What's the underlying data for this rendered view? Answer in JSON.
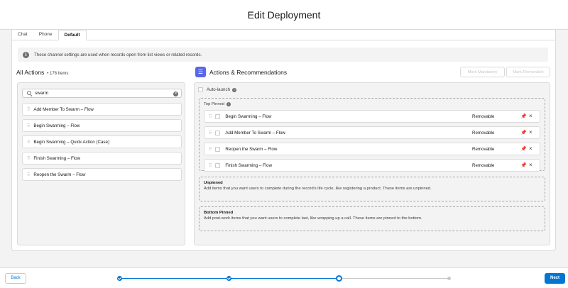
{
  "modal": {
    "title": "Edit Deployment"
  },
  "tabs": [
    {
      "label": "Chat",
      "active": false
    },
    {
      "label": "Phone",
      "active": false
    },
    {
      "label": "Default",
      "active": true
    }
  ],
  "info": {
    "text": "These channel settings are used when records open from list views or related records."
  },
  "all_actions": {
    "title": "All Actions",
    "count": "• 178 Items",
    "search_value": "swarm",
    "items": [
      "Add Member To Swarm – Flow",
      "Begin Swarming – Flow",
      "Begin Swarming – Quick Action (Case)",
      "Finish Swarming – Flow",
      "Reopen the Swarm – Flow"
    ]
  },
  "recommendations": {
    "title": "Actions & Recommendations",
    "icon": "list-icon",
    "mark_mandatory_label": "Mark Mandatory",
    "mark_removable_label": "Mark Removable",
    "auto_launch_label": "Auto-launch",
    "top_pinned_label": "Top Pinned",
    "top_pinned_items": [
      {
        "label": "Begin Swarming – Flow",
        "status": "Removable"
      },
      {
        "label": "Add Member To Swarm – Flow",
        "status": "Removable"
      },
      {
        "label": "Reopen the Swarm – Flow",
        "status": "Removable"
      },
      {
        "label": "Finish Swarming – Flow",
        "status": "Removable"
      }
    ],
    "unpinned": {
      "title": "Unpinned",
      "description": "Add items that you want users to complete during the record's life cycle, like registering a product. These items are unpinned."
    },
    "bottom_pinned": {
      "title": "Bottom Pinned",
      "description": "Add post-work items that you want users to complete last, like wrapping up a call. These items are pinned to the bottom."
    }
  },
  "footer": {
    "back_label": "Back",
    "next_label": "Next",
    "progress": {
      "total_steps": 4,
      "current_step": 3
    }
  },
  "colors": {
    "brand": "#0176d3",
    "icon_accent": "#5867e8"
  }
}
